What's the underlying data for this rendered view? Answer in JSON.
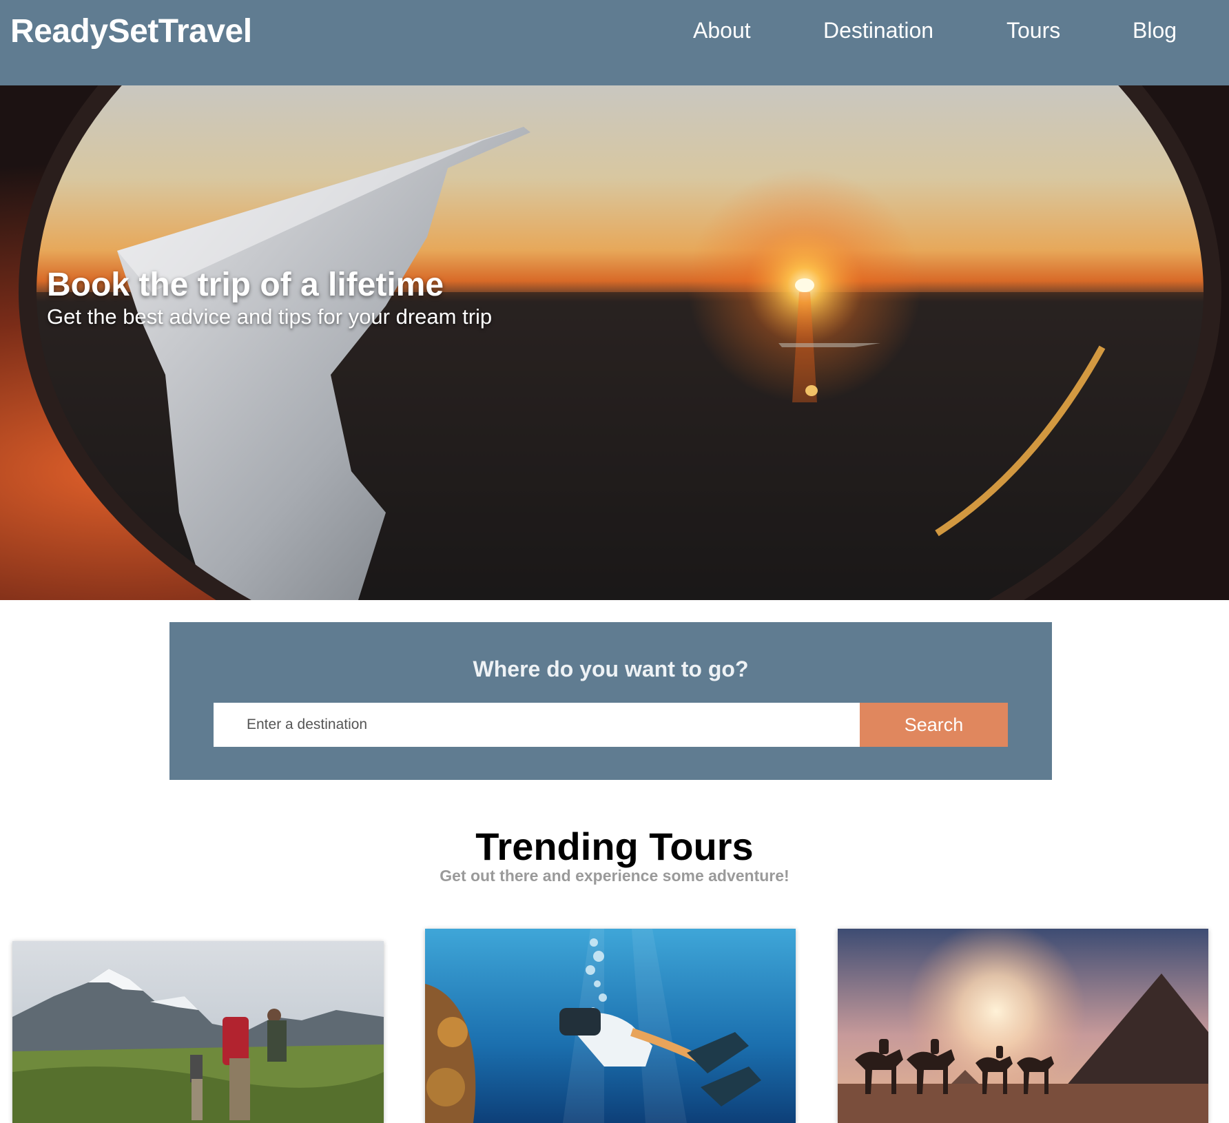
{
  "header": {
    "logo": "ReadySetTravel",
    "nav": {
      "about": "About",
      "destination": "Destination",
      "tours": "Tours",
      "blog": "Blog"
    }
  },
  "hero": {
    "title": "Book the trip of a lifetime",
    "subtitle": "Get the best advice and tips for your dream trip"
  },
  "search": {
    "heading": "Where do you want to go?",
    "placeholder": "Enter a destination",
    "value": "",
    "button_label": "Search"
  },
  "trending": {
    "title": "Trending Tours",
    "subtitle": "Get out there and experience some adventure!",
    "cards": [
      {
        "image": "hiking-mountains-photo"
      },
      {
        "image": "underwater-diver-photo"
      },
      {
        "image": "desert-camels-pyramid-photo"
      }
    ]
  },
  "colors": {
    "header_bg": "#607c91",
    "search_panel_bg": "#607c91",
    "search_button_bg": "#e0875e",
    "text_light": "#ffffff",
    "subtitle_gray": "#9a9a9a"
  }
}
